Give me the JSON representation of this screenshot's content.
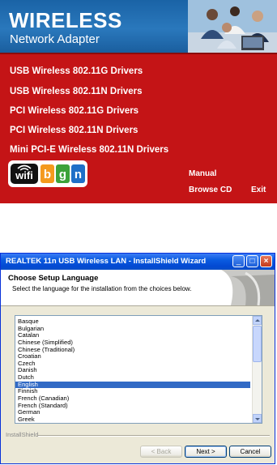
{
  "autorun": {
    "brand_title": "WIRELESS",
    "brand_subtitle": "Network Adapter",
    "menu_items": [
      "USB Wireless 802.11G Drivers",
      "USB Wireless 802.11N Drivers",
      "PCI Wireless 802.11G Drivers",
      "PCI Wireless 802.11N Drivers",
      "Mini PCI-E Wireless 802.11N Drivers"
    ],
    "logo": {
      "wifi": "wifi",
      "b": "b",
      "g": "g",
      "n": "n"
    },
    "manual_label": "Manual",
    "browse_cd_label": "Browse CD",
    "exit_label": "Exit",
    "colors": {
      "background": "#c41416",
      "header": "#2a78bc"
    }
  },
  "installer": {
    "window_title": "REALTEK 11n USB Wireless LAN - InstallShield Wizard",
    "minimize_label": "_",
    "maximize_label": "□",
    "close_label": "×",
    "header_title": "Choose Setup Language",
    "header_description": "Select the language for the installation from the choices below.",
    "languages": [
      "Basque",
      "Bulgarian",
      "Catalan",
      "Chinese (Simplified)",
      "Chinese (Traditional)",
      "Croatian",
      "Czech",
      "Danish",
      "Dutch",
      "English",
      "Finnish",
      "French (Canadian)",
      "French (Standard)",
      "German",
      "Greek"
    ],
    "selected_language": "English",
    "footer_brand": "InstallShield",
    "back_label": "< Back",
    "next_label": "Next >",
    "cancel_label": "Cancel",
    "colors": {
      "titlebar": "#0a5be0",
      "selection": "#316ac5",
      "face": "#ece9d8"
    }
  }
}
